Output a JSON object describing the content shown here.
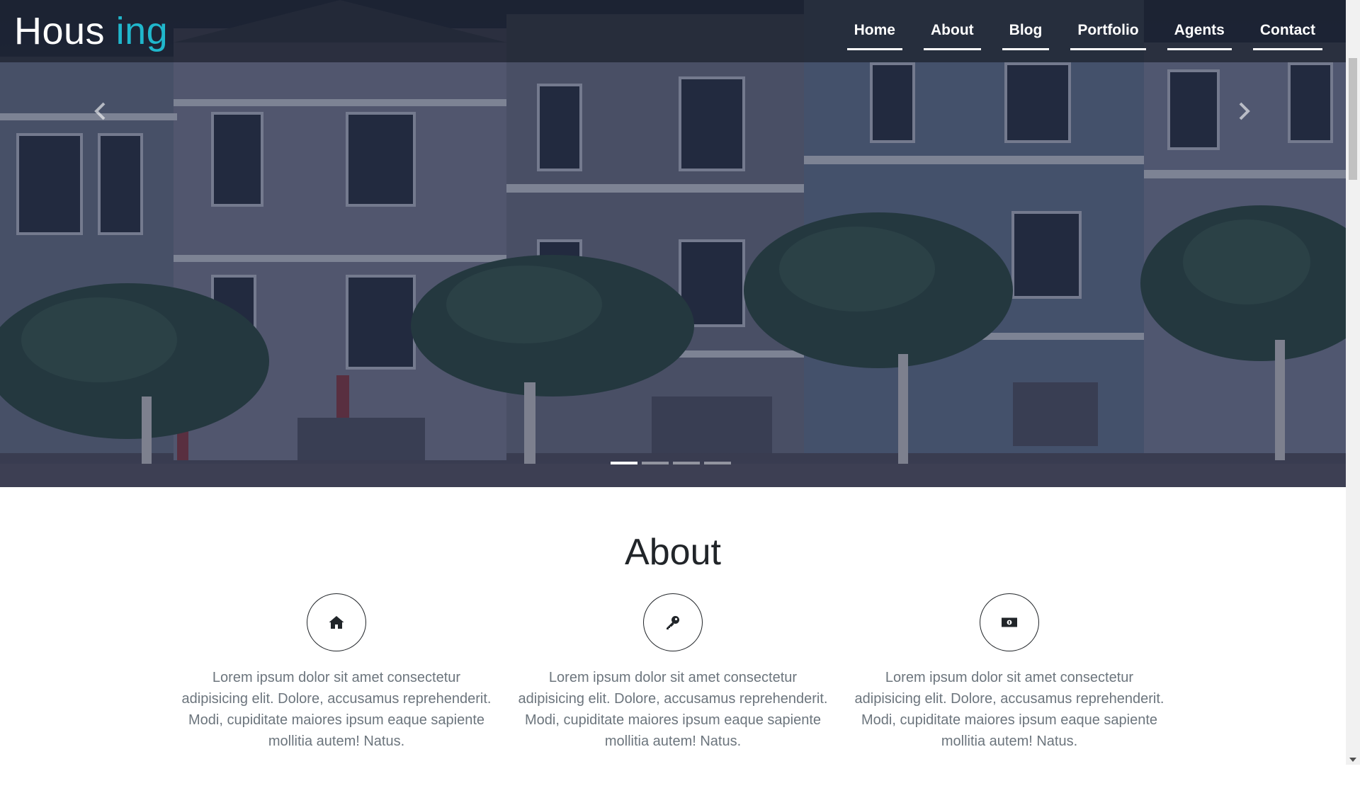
{
  "brand": {
    "part1": "Hous",
    "part2": "ing",
    "accent_color": "#20b7cc"
  },
  "nav": {
    "items": [
      "Home",
      "About",
      "Blog",
      "Portfolio",
      "Agents",
      "Contact"
    ]
  },
  "carousel": {
    "slide_count": 4,
    "active_index": 0,
    "prev_icon": "chevron-left-icon",
    "next_icon": "chevron-right-icon"
  },
  "about": {
    "title": "About",
    "features": [
      {
        "icon": "home-icon",
        "text": "Lorem ipsum dolor sit amet consectetur adipisicing elit. Dolore, accusamus reprehenderit. Modi, cupiditate maiores ipsum eaque sapiente mollitia autem! Natus."
      },
      {
        "icon": "key-icon",
        "text": "Lorem ipsum dolor sit amet consectetur adipisicing elit. Dolore, accusamus reprehenderit. Modi, cupiditate maiores ipsum eaque sapiente mollitia autem! Natus."
      },
      {
        "icon": "money-bill-icon",
        "text": "Lorem ipsum dolor sit amet consectetur adipisicing elit. Dolore, accusamus reprehenderit. Modi, cupiditate maiores ipsum eaque sapiente mollitia autem! Natus."
      }
    ]
  }
}
